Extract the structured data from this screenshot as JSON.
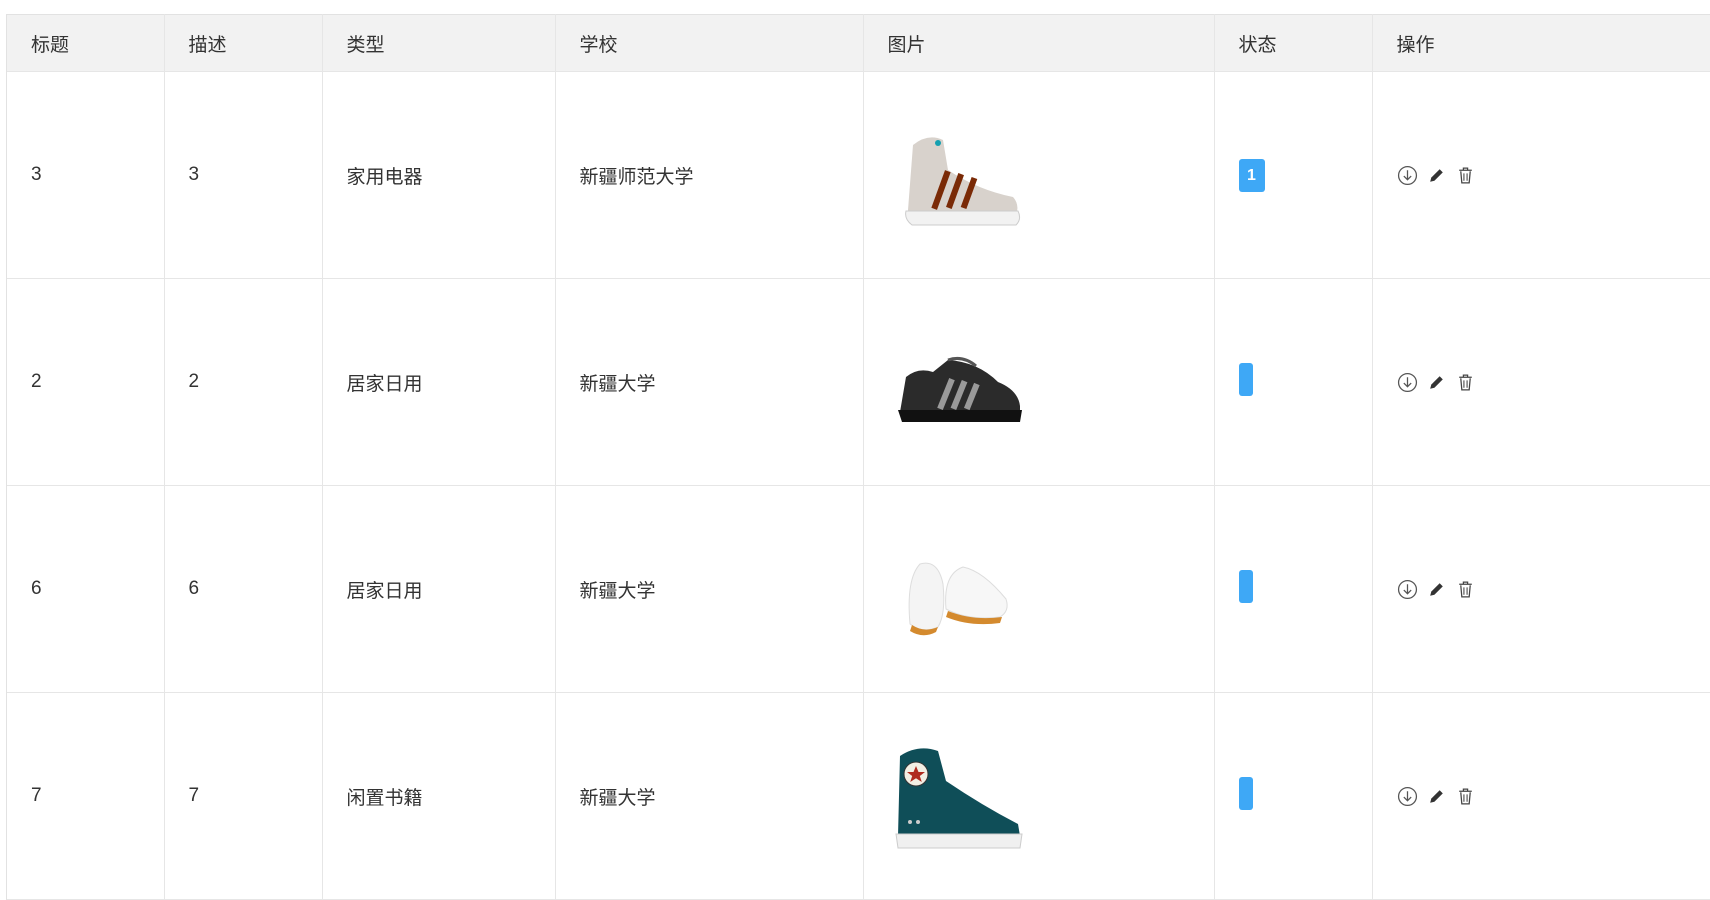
{
  "columns": [
    "标题",
    "描述",
    "类型",
    "学校",
    "图片",
    "状态",
    "操作"
  ],
  "rows": [
    {
      "title": "3",
      "desc": "3",
      "type": "家用电器",
      "school": "新疆师范大学",
      "image": "shoe-high-top-grey",
      "status": "1"
    },
    {
      "title": "2",
      "desc": "2",
      "type": "居家日用",
      "school": "新疆大学",
      "image": "shoe-black-stripes",
      "status": ""
    },
    {
      "title": "6",
      "desc": "6",
      "type": "居家日用",
      "school": "新疆大学",
      "image": "shoe-white-mary-jane",
      "status": ""
    },
    {
      "title": "7",
      "desc": "7",
      "type": "闲置书籍",
      "school": "新疆大学",
      "image": "shoe-teal-high-top",
      "status": ""
    }
  ],
  "actions": [
    "download-icon",
    "edit-icon",
    "trash-icon"
  ],
  "colors": {
    "badge": "#3ea8f6",
    "header_bg": "#f2f2f2",
    "border": "#e6e6e6"
  }
}
